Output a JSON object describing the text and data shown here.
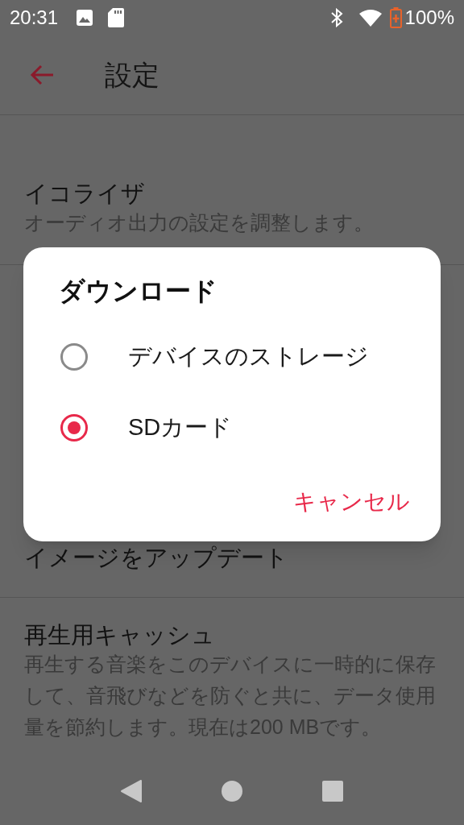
{
  "status_bar": {
    "time": "20:31",
    "battery": "100%"
  },
  "app_bar": {
    "title": "設定"
  },
  "settings": [
    {
      "kind": "item",
      "title": "イコライザ",
      "subtitle": "オーディオ出力の設定を調整します。"
    },
    {
      "kind": "covered",
      "title": "イメージをアップデート"
    },
    {
      "kind": "item",
      "title": "再生用キャッシュ",
      "subtitle": "再生する音楽をこのデバイスに一時的に保存して、音飛びなどを防ぐと共に、データ使用量を節約します。現在は200 MBです。"
    }
  ],
  "dialog": {
    "title": "ダウンロード",
    "options": [
      {
        "label": "デバイスのストレージ",
        "selected": false
      },
      {
        "label": "SDカード",
        "selected": true
      }
    ],
    "cancel": "キャンセル"
  }
}
